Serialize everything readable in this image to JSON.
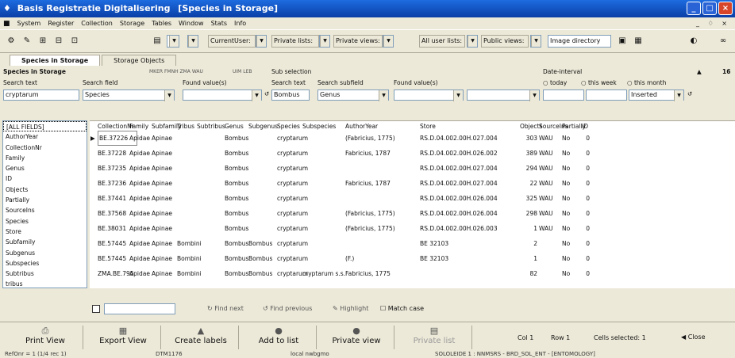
{
  "window": {
    "title_app": "Basis Registratie Digitalisering",
    "title_doc": "[Species in Storage]"
  },
  "menu": [
    "System",
    "Register",
    "Collection",
    "Storage",
    "Tables",
    "Window",
    "Stats",
    "Info"
  ],
  "toolbar": {
    "current_user": "CurrentUser:",
    "private_lists": "Private lists:",
    "private_views": "Private views:",
    "all_user_lists": "All user lists:",
    "public_views": "Public views:",
    "image_directory": "Image directory"
  },
  "tabs": [
    "Species in Storage",
    "Storage Objects"
  ],
  "filter": {
    "title": "Species in Storage",
    "collections": "MKER  FMNH  ZMA  WAU",
    "extra": "UIM  LEB",
    "sub_selection": "Sub selection",
    "date_interval": "Date-interval",
    "count": "16",
    "search_text_label": "Search text",
    "search_text_value": "cryptarum",
    "search_field_label": "Search field",
    "search_field_value": "Species",
    "found_value_label": "Found value(s)",
    "sub_search_text_label": "Search text",
    "sub_search_text_value": "Bombus",
    "sub_search_field_label": "Search subfield",
    "sub_search_field_value": "Genus",
    "sub_found_label": "Found value(s)",
    "today": "today",
    "this_week": "this week",
    "this_month": "this month",
    "date_field_value": "Inserted"
  },
  "fields": [
    "[ALL FIELDS]",
    "AuthorYear",
    "CollectionNr",
    "Family",
    "Genus",
    "ID",
    "Objects",
    "Partially",
    "SourceIns",
    "Species",
    "Store",
    "Subfamily",
    "Subgenus",
    "Subspecies",
    "Subtribus",
    "tribus"
  ],
  "columns": [
    "CollectionNr",
    "Family",
    "Subfamily",
    "Tribus",
    "Subtribus",
    "Genus",
    "Subgenus",
    "Species",
    "Subspecies",
    "AuthorYear",
    "Store",
    "Objects",
    "SourceIns",
    "Partially",
    "ID"
  ],
  "rows": [
    [
      "BE.37226",
      "Apidae",
      "Apinae",
      "",
      "",
      "Bombus",
      "",
      "cryptarum",
      "",
      "(Fabricius, 1775)",
      "RS.D.04.002.00H.027.004",
      "303",
      "WAU",
      "No",
      "0"
    ],
    [
      "BE.37228",
      "Apidae",
      "Apinae",
      "",
      "",
      "Bombus",
      "",
      "cryptarum",
      "",
      "Fabricius, 1787",
      "RS.D.04.002.00H.026.002",
      "389",
      "WAU",
      "No",
      "0"
    ],
    [
      "BE.37235",
      "Apidae",
      "Apinae",
      "",
      "",
      "Bombus",
      "",
      "cryptarum",
      "",
      "",
      "RS.D.04.002.00H.027.004",
      "294",
      "WAU",
      "No",
      "0"
    ],
    [
      "BE.37236",
      "Apidae",
      "Apinae",
      "",
      "",
      "Bombus",
      "",
      "cryptarum",
      "",
      "Fabricius, 1787",
      "RS.D.04.002.00H.027.004",
      "22",
      "WAU",
      "No",
      "0"
    ],
    [
      "BE.37441",
      "Apidae",
      "Apinae",
      "",
      "",
      "Bombus",
      "",
      "cryptarum",
      "",
      "",
      "RS.D.04.002.00H.026.004",
      "325",
      "WAU",
      "No",
      "0"
    ],
    [
      "BE.37568",
      "Apidae",
      "Apinae",
      "",
      "",
      "Bombus",
      "",
      "cryptarum",
      "",
      "(Fabricius, 1775)",
      "RS.D.04.002.00H.026.004",
      "298",
      "WAU",
      "No",
      "0"
    ],
    [
      "BE.38031",
      "Apidae",
      "Apinae",
      "",
      "",
      "Bombus",
      "",
      "cryptarum",
      "",
      "(Fabricius, 1775)",
      "RS.D.04.002.00H.026.003",
      "1",
      "WAU",
      "No",
      "0"
    ],
    [
      "BE.57445",
      "Apidae",
      "Apinae",
      "Bombini",
      "",
      "Bombus",
      "Bombus",
      "cryptarum",
      "",
      "",
      "BE 32103",
      "2",
      "",
      "No",
      "0"
    ],
    [
      "BE.57445",
      "Apidae",
      "Apinae",
      "Bombini",
      "",
      "Bombus",
      "Bombus",
      "cryptarum",
      "",
      "(F.)",
      "BE 32103",
      "1",
      "",
      "No",
      "0"
    ],
    [
      "ZMA.BE.795",
      "Apidae",
      "Apinae",
      "Bombini",
      "",
      "Bombus",
      "Bombus",
      "cryptarum",
      "cryptarum s.s.",
      "Fabricius, 1775",
      "",
      "82",
      "",
      "No",
      "0"
    ]
  ],
  "find": {
    "find_next": "Find next",
    "find_previous": "Find previous",
    "highlight": "Highlight",
    "match_case": "Match case"
  },
  "bottom": {
    "print_view": "Print View",
    "export_view": "Export View",
    "create_labels": "Create labels",
    "add_to_list": "Add to list",
    "private_view": "Private view",
    "private_list": "Private list",
    "col": "Col 1",
    "row": "Row 1",
    "cells_selected": "Cells selected: 1",
    "close": "Close"
  },
  "status": {
    "left": "RefOnr = 1 (1/4 rec 1)",
    "mid": "DTM1176",
    "db": "local nwbgmo",
    "right": "SOLOLEIDE 1 : NNMSRS - BRD_SOL_ENT - [ENTOMOLOGY]"
  }
}
